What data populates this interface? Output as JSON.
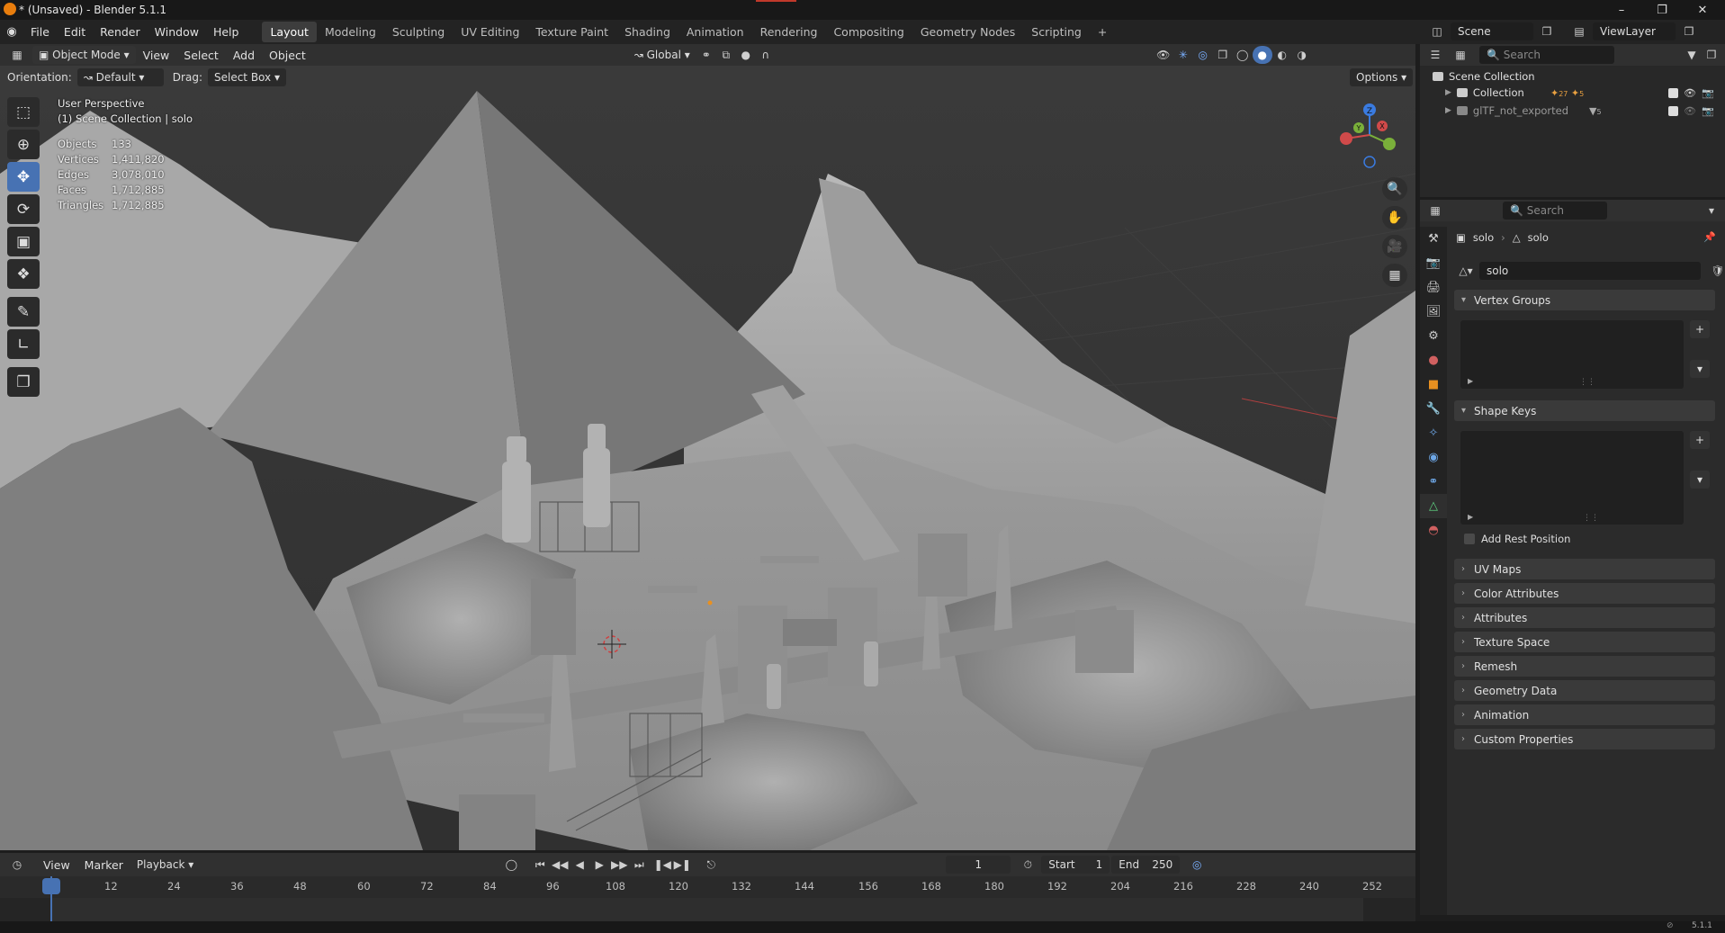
{
  "window": {
    "title": "* (Unsaved) - Blender 5.1.1"
  },
  "menu": [
    "File",
    "Edit",
    "Render",
    "Window",
    "Help"
  ],
  "workspaces": [
    "Layout",
    "Modeling",
    "Sculpting",
    "UV Editing",
    "Texture Paint",
    "Shading",
    "Animation",
    "Rendering",
    "Compositing",
    "Geometry Nodes",
    "Scripting"
  ],
  "active_workspace": "Layout",
  "scene": {
    "name": "Scene",
    "view_layer": "ViewLayer"
  },
  "viewport_header": {
    "mode": "Object Mode",
    "menus": [
      "View",
      "Select",
      "Add",
      "Object"
    ],
    "transform_orientation": "Global"
  },
  "tool_header": {
    "orientation_label": "Orientation:",
    "orientation_value": "Default",
    "drag_label": "Drag:",
    "drag_value": "Select Box",
    "options_label": "Options"
  },
  "overlay": {
    "view_name": "User Perspective",
    "collection_info": "(1) Scene Collection | solo",
    "stats": [
      {
        "label": "Objects",
        "value": "133"
      },
      {
        "label": "Vertices",
        "value": "1,411,820"
      },
      {
        "label": "Edges",
        "value": "3,078,010"
      },
      {
        "label": "Faces",
        "value": "1,712,885"
      },
      {
        "label": "Triangles",
        "value": "1,712,885"
      }
    ]
  },
  "gizmo": {
    "x": "X",
    "y": "Y",
    "z": "Z"
  },
  "outliner": {
    "search_placeholder": "Search",
    "root": "Scene Collection",
    "items": [
      {
        "name": "Collection",
        "count": "5"
      },
      {
        "name": "glTF_not_exported",
        "count": "5"
      }
    ],
    "collection_extra_count": "27"
  },
  "properties": {
    "search_placeholder": "Search",
    "breadcrumb_object": "solo",
    "breadcrumb_data": "solo",
    "mesh_name": "solo",
    "panels_open": [
      "Vertex Groups",
      "Shape Keys"
    ],
    "add_rest_position": "Add Rest Position",
    "panels_closed": [
      "UV Maps",
      "Color Attributes",
      "Attributes",
      "Texture Space",
      "Remesh",
      "Geometry Data",
      "Animation",
      "Custom Properties"
    ]
  },
  "timeline": {
    "menus": [
      "View",
      "Marker",
      "Playback"
    ],
    "current_frame": "1",
    "start_label": "Start",
    "start_value": "1",
    "end_label": "End",
    "end_value": "250",
    "ruler": [
      "1",
      "12",
      "24",
      "36",
      "48",
      "60",
      "72",
      "84",
      "96",
      "108",
      "120",
      "132",
      "144",
      "156",
      "168",
      "180",
      "192",
      "204",
      "216",
      "228",
      "240",
      "252"
    ]
  },
  "statusbar": {
    "version": "5.1.1"
  },
  "colors": {
    "accent": "#4772b3",
    "header": "#303030",
    "panel": "#2b2b2b",
    "playhead": "#4772b3"
  }
}
